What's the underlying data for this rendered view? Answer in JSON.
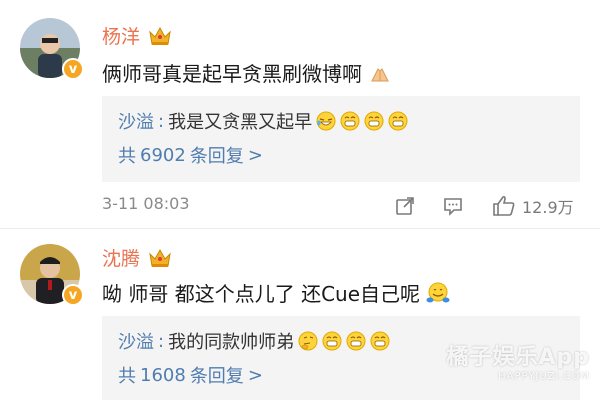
{
  "comments": [
    {
      "author": "杨洋",
      "text": "俩师哥真是起早贪黑刷微博啊",
      "reply": {
        "author": "沙溢",
        "separator": ":",
        "text": "我是又贪黑又起早",
        "count_prefix": "共",
        "count": "6902",
        "count_suffix": "条回复",
        "chevron": ">"
      },
      "date": "3-11 08:03",
      "likes": "12.9万"
    },
    {
      "author": "沈腾",
      "text": "呦 师哥 都这个点儿了 还Cue自己呢",
      "reply": {
        "author": "沙溢",
        "separator": ":",
        "text": "我的同款帅师弟",
        "count_prefix": "共",
        "count": "1608",
        "count_suffix": "条回复",
        "chevron": ">"
      }
    }
  ],
  "icons": {
    "verified": "verified-badge-icon",
    "crown": "crown-icon",
    "share": "share-icon",
    "comment": "comment-icon",
    "like": "thumbs-up-icon"
  },
  "colors": {
    "author_name": "#eb7350",
    "link_blue": "#507daf",
    "verified": "#f5a623",
    "reply_bg": "#f4f4f4"
  },
  "verified_mark": "v",
  "watermark": {
    "title": "橘子娱乐App",
    "subtitle": "HAPPYJUZI.COM"
  }
}
